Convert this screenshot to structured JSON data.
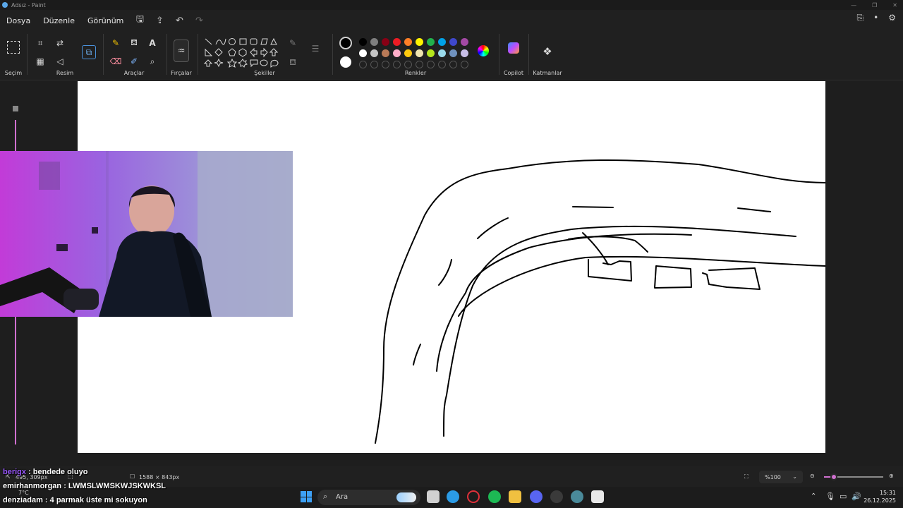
{
  "window": {
    "title": "Adsız - Paint"
  },
  "menu": {
    "file": "Dosya",
    "edit": "Düzenle",
    "view": "Görünüm"
  },
  "ribbon": {
    "selection_label": "Seçim",
    "image_label": "Resim",
    "tools_label": "Araçlar",
    "brushes_label": "Fırçalar",
    "shapes_label": "Şekiller",
    "colors_label": "Renkler",
    "copilot_label": "Copilot",
    "layers_label": "Katmanlar"
  },
  "colors": {
    "row1": [
      "#000000",
      "#7f7f7f",
      "#880015",
      "#ed1c24",
      "#ff7f27",
      "#fff200",
      "#22b14c",
      "#00a2e8",
      "#3f48cc",
      "#a349a4"
    ],
    "row2": [
      "#ffffff",
      "#c3c3c3",
      "#b97a57",
      "#ffaec9",
      "#ffc90e",
      "#efe4b0",
      "#b5e61d",
      "#99d9ea",
      "#7092be",
      "#c8bfe7"
    ],
    "primary": "#000000",
    "secondary": "#ffffff"
  },
  "status": {
    "cursor_pos": "495, 309px",
    "canvas_size": "1588 × 843px",
    "zoom": "%100"
  },
  "chat": [
    {
      "user": "berigx",
      "sep": " : ",
      "msg": "bendede oluyo"
    },
    {
      "user": "emirhanmorgan",
      "sep": " : ",
      "msg": "LWMSLWMSKWJSKWKSL"
    },
    {
      "user": "denziadam",
      "sep": " : ",
      "msg": "4 parmak üste mi sokuyon"
    }
  ],
  "taskbar": {
    "search_placeholder": "Ara",
    "weather": "7°C",
    "time": "15:31",
    "date": "26.12.2025"
  }
}
